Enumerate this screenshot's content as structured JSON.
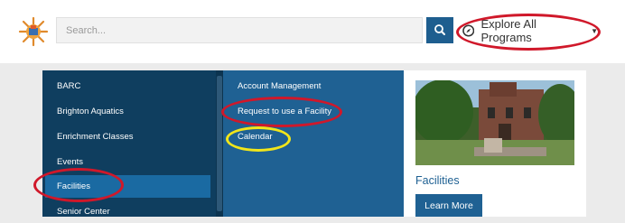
{
  "header": {
    "search": {
      "placeholder": "Search..."
    },
    "explore": {
      "label": "Explore All Programs"
    }
  },
  "menu": {
    "categories": [
      "BARC",
      "Brighton Aquatics",
      "Enrichment Classes",
      "Events",
      "Facilities",
      "Senior Center"
    ],
    "active_category": "Facilities",
    "submenu": [
      "Account Management",
      "Request to use a Facility",
      "Calendar"
    ],
    "feature": {
      "title": "Facilities",
      "button_label": "Learn More"
    }
  },
  "colors": {
    "brand_blue": "#1f6193",
    "menu_dark": "#0f3e5f",
    "annotation_red": "#d0182a",
    "annotation_yellow": "#f2e61a"
  }
}
